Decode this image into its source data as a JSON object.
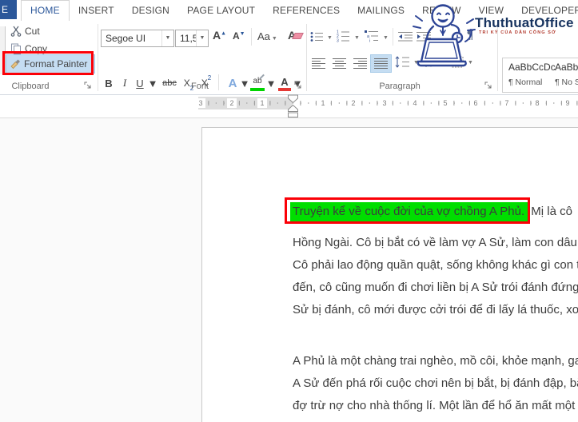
{
  "tabs": {
    "file_partial": "E",
    "items": [
      {
        "label": "HOME"
      },
      {
        "label": "INSERT"
      },
      {
        "label": "DESIGN"
      },
      {
        "label": "PAGE LAYOUT"
      },
      {
        "label": "REFERENCES"
      },
      {
        "label": "MAILINGS"
      },
      {
        "label": "REVIEW"
      },
      {
        "label": "VIEW"
      },
      {
        "label": "DEVELOPER"
      }
    ],
    "active_tab": "HOME"
  },
  "ribbon": {
    "clipboard": {
      "cut": "Cut",
      "copy": "Copy",
      "format_painter": "Format Painter",
      "label": "Clipboard"
    },
    "font": {
      "name_value": "Segoe UI",
      "size_value": "11,5",
      "bold": "B",
      "italic": "I",
      "underline": "U",
      "strikethrough": "abc",
      "sub_base": "X",
      "sub_small": "2",
      "sup_base": "X",
      "sup_small": "2",
      "grow_font": "A",
      "shrink_font": "A",
      "change_case": "Aa",
      "clear_format": "A",
      "text_effects": "A",
      "highlight_ab": "ab",
      "font_color_a": "A",
      "label": "Font"
    },
    "paragraph": {
      "pilcrow": "¶",
      "label": "Paragraph"
    },
    "styles": {
      "items": [
        {
          "preview": "AaBbCcDc",
          "name": "¶ Normal"
        },
        {
          "preview": "AaBb",
          "name": "¶ No S"
        }
      ]
    }
  },
  "ruler": {
    "left": [
      "3",
      "2",
      "1"
    ],
    "right": [
      "1",
      "2",
      "3",
      "4",
      "5",
      "6",
      "7",
      "8",
      "9"
    ]
  },
  "logo": {
    "brand": "ThuthuatOffice",
    "tagline": "TRI KỶ CỦA DÂN CÔNG SỞ"
  },
  "document": {
    "highlighted_sentence": "Truyện kể về cuộc đời của vợ chồng A Phủ.",
    "after_highlight": "Mị là cô",
    "p1_lines": [
      "Hồng Ngài. Cô bị bắt có về làm vợ A Sử, làm con dâu g",
      "Cô phải lao động quần quật, sống không khác gì con t",
      "đến, cô cũng muốn đi chơi liền bị A Sử trói đánh đứng",
      "Sử bị đánh, cô mới được cởi trói để đi lấy lá thuốc, xoa"
    ],
    "p2_lines": [
      "A Phủ là một chàng trai nghèo, mồ côi, khỏe mạnh, gan",
      "A Sử đến phá rối cuộc chơi nên bị bắt, bị đánh đập, bắt",
      "đợ trừ nợ cho nhà thống lí. Một lần để hổ ăn mất một"
    ]
  },
  "colors": {
    "accent_blue": "#2b579a",
    "highlight_green": "#00de00",
    "annotation_red": "#fb0007",
    "selection_blue": "#c5ddf2"
  }
}
